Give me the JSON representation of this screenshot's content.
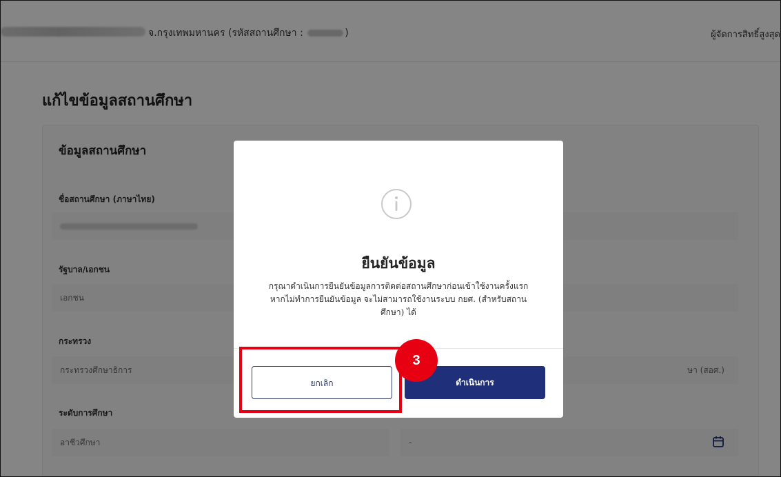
{
  "header": {
    "school_location": "จ.กรุงเทพมหานคร (รหัสสถานศึกษา :",
    "school_code_close": ")",
    "user_role": "ผู้จัดการสิทธิ์สูงสุด"
  },
  "page": {
    "title": "แก้ไขข้อมูลสถานศึกษา",
    "card_title": "ข้อมูลสถานศึกษา",
    "fields": {
      "name_label": "ชื่อสถานศึกษา (ภาษาไทย)",
      "sector_label": "รัฐบาล/เอกชน",
      "sector_value": "เอกชน",
      "ministry_label": "กระทรวง",
      "ministry_value": "กระทรวงศึกษาธิการ",
      "agency_value_partial": "ษา (สอศ.)",
      "level_label": "ระดับการศึกษา",
      "level_value": "อาชีวศึกษา",
      "date_value": "-"
    }
  },
  "modal": {
    "icon": "info-icon",
    "title": "ยืนยันข้อมูล",
    "message": "กรุณาดำเนินการยืนยันข้อมูลการติดต่อสถานศึกษาก่อนเข้าใช้งานครั้งแรก หากไม่ทำการยืนยันข้อมูล จะไม่สามารถใช้งานระบบ กยศ. (สำหรับสถานศึกษา) ได้",
    "cancel_label": "ยกเลิก",
    "confirm_label": "ดำเนินการ"
  },
  "annotation": {
    "step_number": "3"
  },
  "colors": {
    "primary": "#1f2f7a",
    "annotation_red": "#e60012"
  }
}
